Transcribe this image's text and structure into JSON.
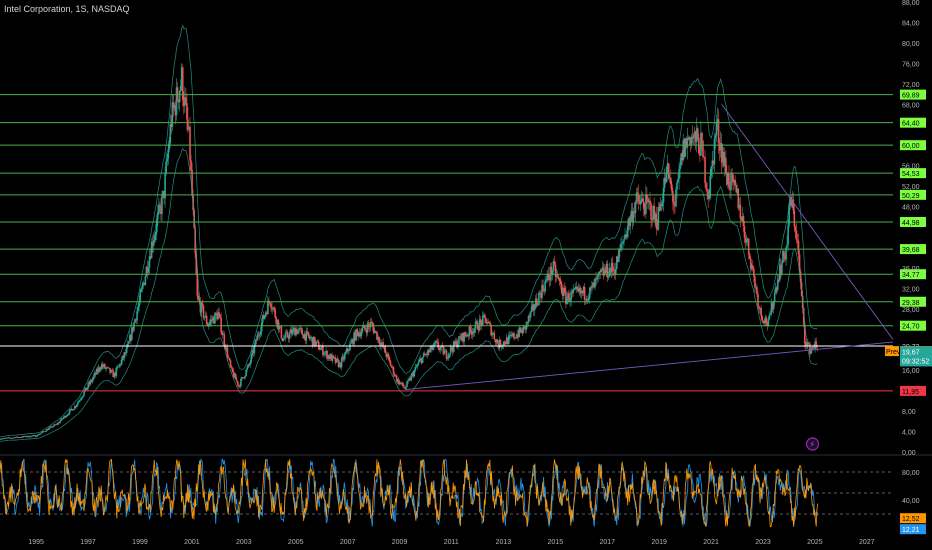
{
  "header": {
    "title": "Intel Corporation, 1S, NASDAQ"
  },
  "chart_data": {
    "type": "candlestick",
    "ylim": [
      0,
      88
    ],
    "xlim": [
      1993.6,
      2028
    ],
    "y_ticks": [
      "88,00",
      "84,00",
      "80,00",
      "76,00",
      "72,00",
      "68,00",
      "56,00",
      "52,00",
      "48,00",
      "36,00",
      "32,00",
      "28,00",
      "16,00",
      "8,00",
      "4,00",
      "0,00"
    ],
    "y_tick_values": [
      88,
      84,
      80,
      76,
      72,
      68,
      56,
      52,
      48,
      36,
      32,
      28,
      16,
      8,
      4,
      0
    ],
    "x_ticks": [
      "1995",
      "1997",
      "1999",
      "2001",
      "2003",
      "2005",
      "2007",
      "2009",
      "2011",
      "2013",
      "2015",
      "2017",
      "2019",
      "2021",
      "2023",
      "2025",
      "2027"
    ],
    "x_tick_values": [
      1995,
      1997,
      1999,
      2001,
      2003,
      2005,
      2007,
      2009,
      2011,
      2013,
      2015,
      2017,
      2019,
      2021,
      2023,
      2025,
      2027
    ],
    "price_path": [
      [
        1993.6,
        2.6
      ],
      [
        1995,
        3.2
      ],
      [
        1995.8,
        5.5
      ],
      [
        1996.5,
        9
      ],
      [
        1997,
        13
      ],
      [
        1997.5,
        17
      ],
      [
        1998,
        15
      ],
      [
        1998.5,
        20
      ],
      [
        1999,
        30
      ],
      [
        1999.5,
        42
      ],
      [
        1999.9,
        50
      ],
      [
        2000.2,
        65
      ],
      [
        2000.6,
        73
      ],
      [
        2000.9,
        60
      ],
      [
        2001.2,
        30
      ],
      [
        2001.6,
        25
      ],
      [
        2002,
        27
      ],
      [
        2002.5,
        16
      ],
      [
        2002.8,
        13
      ],
      [
        2003.2,
        17
      ],
      [
        2003.6,
        24
      ],
      [
        2004,
        30
      ],
      [
        2004.5,
        22
      ],
      [
        2005,
        24
      ],
      [
        2005.6,
        22
      ],
      [
        2006.2,
        19
      ],
      [
        2006.7,
        17
      ],
      [
        2007.3,
        23
      ],
      [
        2007.9,
        25
      ],
      [
        2008.4,
        20
      ],
      [
        2008.9,
        14
      ],
      [
        2009.2,
        12.5
      ],
      [
        2009.8,
        18
      ],
      [
        2010.4,
        21
      ],
      [
        2010.8,
        19
      ],
      [
        2011.3,
        22
      ],
      [
        2011.8,
        24
      ],
      [
        2012.3,
        26
      ],
      [
        2012.8,
        21
      ],
      [
        2013.2,
        22
      ],
      [
        2013.8,
        24
      ],
      [
        2014.4,
        31
      ],
      [
        2014.9,
        36
      ],
      [
        2015.4,
        30
      ],
      [
        2015.8,
        31
      ],
      [
        2016.3,
        31
      ],
      [
        2016.8,
        35
      ],
      [
        2017.3,
        36
      ],
      [
        2017.7,
        43
      ],
      [
        2018.1,
        49
      ],
      [
        2018.6,
        48
      ],
      [
        2018.9,
        45
      ],
      [
        2019.3,
        55
      ],
      [
        2019.6,
        48
      ],
      [
        2019.9,
        59
      ],
      [
        2020.2,
        62
      ],
      [
        2020.6,
        60
      ],
      [
        2020.9,
        50
      ],
      [
        2021.2,
        64
      ],
      [
        2021.6,
        54
      ],
      [
        2022,
        50
      ],
      [
        2022.5,
        38
      ],
      [
        2022.9,
        27
      ],
      [
        2023.2,
        25
      ],
      [
        2023.6,
        35
      ],
      [
        2023.9,
        40
      ],
      [
        2024.05,
        50
      ],
      [
        2024.3,
        42
      ],
      [
        2024.6,
        22
      ],
      [
        2024.8,
        20
      ],
      [
        2025.0,
        21
      ],
      [
        2025.1,
        19.67
      ]
    ],
    "horizontal_levels": [
      {
        "value": 69.89,
        "label": "69,89",
        "color": "#4caf50",
        "badge": "#7cff3f"
      },
      {
        "value": 64.4,
        "label": "64,40",
        "color": "#4caf50",
        "badge": "#7cff3f"
      },
      {
        "value": 60.0,
        "label": "60,00",
        "color": "#4caf50",
        "badge": "#7cff3f"
      },
      {
        "value": 54.53,
        "label": "54,53",
        "color": "#4caf50",
        "badge": "#7cff3f"
      },
      {
        "value": 50.29,
        "label": "50,29",
        "color": "#4caf50",
        "badge": "#7cff3f"
      },
      {
        "value": 44.98,
        "label": "44,98",
        "color": "#4caf50",
        "badge": "#7cff3f"
      },
      {
        "value": 39.68,
        "label": "39,68",
        "color": "#4caf50",
        "badge": "#7cff3f"
      },
      {
        "value": 34.77,
        "label": "34,77",
        "color": "#4caf50",
        "badge": "#7cff3f"
      },
      {
        "value": 29.38,
        "label": "29,38",
        "color": "#4caf50",
        "badge": "#7cff3f"
      },
      {
        "value": 24.7,
        "label": "24,70",
        "color": "#4caf50",
        "badge": "#7cff3f"
      },
      {
        "value": 20.72,
        "label": "20,72",
        "color": "#ffffff",
        "badge": null
      },
      {
        "value": 11.95,
        "label": "11,95",
        "color": "#f23645",
        "badge": "#f23645"
      }
    ],
    "price_badges": [
      {
        "value": 19.73,
        "label": "19,73",
        "prefix": "Prev",
        "color": "#ff9800"
      },
      {
        "value": 19.67,
        "label": "19,67",
        "color": "#26a69a"
      }
    ],
    "countdown": "09:32:52",
    "trendlines": [
      {
        "from": [
          2009.2,
          12.2
        ],
        "to": [
          2028,
          21.5
        ],
        "color": "#7e57c2"
      },
      {
        "from": [
          2021.4,
          68
        ],
        "to": [
          2028,
          22
        ],
        "color": "#7e57c2"
      }
    ],
    "oscillator": {
      "y_ticks": [
        "80,00",
        "40,00",
        "0,00"
      ],
      "y_tick_values": [
        80,
        40,
        0
      ],
      "ylim": [
        0,
        100
      ],
      "dashed_levels": [
        80,
        50,
        20
      ],
      "k_label": "12,52",
      "d_label": "12,21",
      "k_color": "#ff9800",
      "d_color": "#2196f3"
    },
    "colors": {
      "up": "#26a69a",
      "down": "#ef5350",
      "envelope": "#26a69a"
    }
  }
}
